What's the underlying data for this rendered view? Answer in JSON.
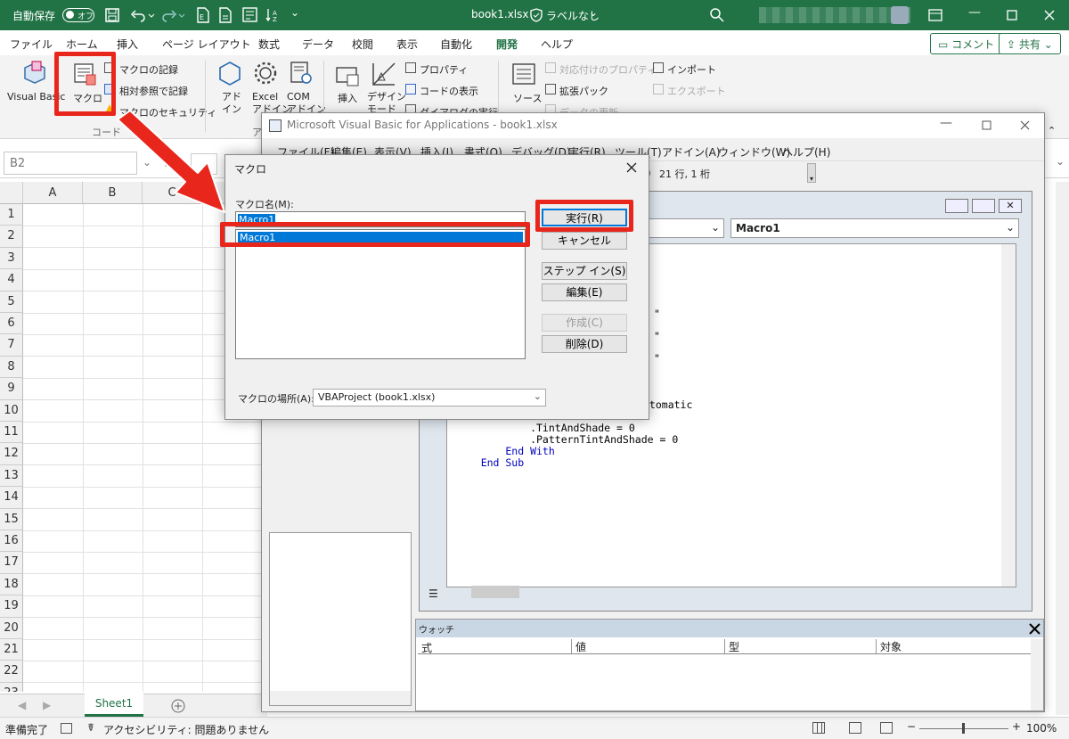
{
  "excel": {
    "title": {
      "autosave": "自動保存",
      "toggle": "オフ",
      "filename": "book1.xlsx",
      "label": "ラベルなし"
    },
    "tabs": [
      "ファイル",
      "ホーム",
      "挿入",
      "ページ レイアウト",
      "数式",
      "データ",
      "校閲",
      "表示",
      "自動化",
      "開発",
      "ヘルプ"
    ],
    "comment_button": "コメント",
    "share_button": "共有",
    "ribbon": {
      "visual_basic": "Visual Basic",
      "macro": "マクロ",
      "record": "マクロの記録",
      "relative": "相対参照で記録",
      "security": "マクロのセキュリティ",
      "code_group": "コード",
      "addin": "アド\nイン",
      "excel_addin": "Excel\nアドイン",
      "com_addin": "COM\nアドイン",
      "addin_group": "ア",
      "insert": "挿入",
      "design": "デザイン\nモード",
      "properties": "プロパティ",
      "view_code": "コードの表示",
      "dialog": "ダイアログの実行",
      "source": "ソース",
      "map_props": "対応付けのプロパティ",
      "expansion": "拡張パック",
      "refresh": "データの更新",
      "import": "インポート",
      "export": "エクスポート"
    },
    "namebox": "B2",
    "fx": "fx",
    "columns": [
      "A",
      "B",
      "C"
    ],
    "rows": [
      "1",
      "2",
      "3",
      "4",
      "5",
      "6",
      "7",
      "8",
      "9",
      "10",
      "11",
      "12",
      "13",
      "14",
      "15",
      "16",
      "17",
      "18",
      "19",
      "20",
      "21",
      "22",
      "23"
    ],
    "sheet": "Sheet1",
    "status": {
      "ready": "準備完了",
      "accessibility": "アクセシビリティ: 問題ありません",
      "zoom": "100%"
    }
  },
  "vbe": {
    "title": "Microsoft Visual Basic for Applications - book1.xlsx",
    "menu": [
      "ファイル(F)",
      "編集(E)",
      "表示(V)",
      "挿入(I)",
      "書式(O)",
      "デバッグ(D)",
      "実行(R)",
      "ツール(T)",
      "アドイン(A)",
      "ウィンドウ(W)",
      "ヘルプ(H)"
    ],
    "position": "21 行, 1 桁",
    "proc_combo": "Macro1",
    "code_frag": [
      "\"",
      "\"",
      "\"",
      "utomatic"
    ],
    "code_lines": [
      "            .TintAndShade = 0",
      "            .PatternTintAndShade = 0",
      "        End With",
      "    End Sub"
    ],
    "watch": {
      "title": "ウォッチ",
      "cols": [
        "式",
        "値",
        "型",
        "対象"
      ]
    }
  },
  "dialog": {
    "title": "マクロ",
    "name_label": "マクロ名(M):",
    "name_value": "Macro1",
    "list": [
      "Macro1"
    ],
    "run": "実行(R)",
    "cancel": "キャンセル",
    "step": "ステップ イン(S)",
    "edit": "編集(E)",
    "create": "作成(C)",
    "delete": "削除(D)",
    "location_label": "マクロの場所(A):",
    "location_value": "VBAProject (book1.xlsx)"
  },
  "colors": {
    "excel_green": "#217346",
    "highlight": "#e8261c",
    "selection": "#0078d7"
  }
}
